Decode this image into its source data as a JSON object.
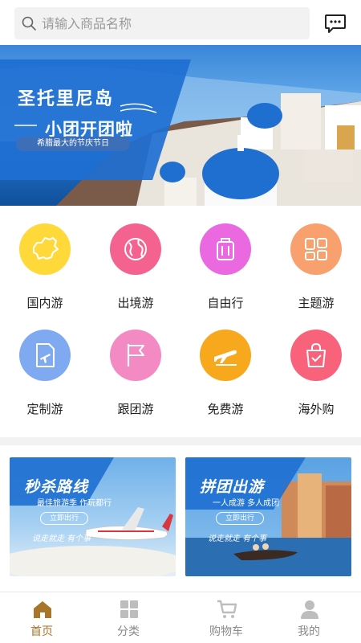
{
  "search": {
    "placeholder": "请输入商品名称",
    "icon": "search-icon"
  },
  "header": {
    "message_icon": "chat-bubble-icon"
  },
  "banner": {
    "title": "圣托里尼岛",
    "subtitle": "小团开团啦",
    "tag": "希腊最大的节庆节日"
  },
  "categories": [
    {
      "label": "国内游",
      "icon": "china-map-icon",
      "color": "#ffd93a"
    },
    {
      "label": "出境游",
      "icon": "globe-icon",
      "color": "#f4638f"
    },
    {
      "label": "自由行",
      "icon": "luggage-icon",
      "color": "#ea68e0"
    },
    {
      "label": "主题游",
      "icon": "grid-icon",
      "color": "#f9a06f"
    },
    {
      "label": "定制游",
      "icon": "ticket-plane-icon",
      "color": "#7fa9f1"
    },
    {
      "label": "跟团游",
      "icon": "flag-icon",
      "color": "#f48ac4"
    },
    {
      "label": "免费游",
      "icon": "plane-icon",
      "color": "#f7a81c"
    },
    {
      "label": "海外购",
      "icon": "shopping-bag-icon",
      "color": "#f8627a"
    }
  ],
  "promos": [
    {
      "title": "秒杀路线",
      "subtitle": "最佳旅游季 作玩都行",
      "button": "立即出行",
      "sign": "说走就走 有个事"
    },
    {
      "title": "拼团出游",
      "subtitle": "一人成游 多人成团",
      "button": "立即出行",
      "sign": "说走就走 有个事"
    }
  ],
  "tabs": [
    {
      "label": "首页",
      "icon": "home-icon",
      "active": true
    },
    {
      "label": "分类",
      "icon": "category-grid-icon",
      "active": false
    },
    {
      "label": "购物车",
      "icon": "cart-icon",
      "active": false
    },
    {
      "label": "我的",
      "icon": "user-icon",
      "active": false
    }
  ],
  "colors": {
    "accent": "#a8762a",
    "inactive": "#bdbdbd",
    "banner_blue": "#1e6fd2"
  }
}
